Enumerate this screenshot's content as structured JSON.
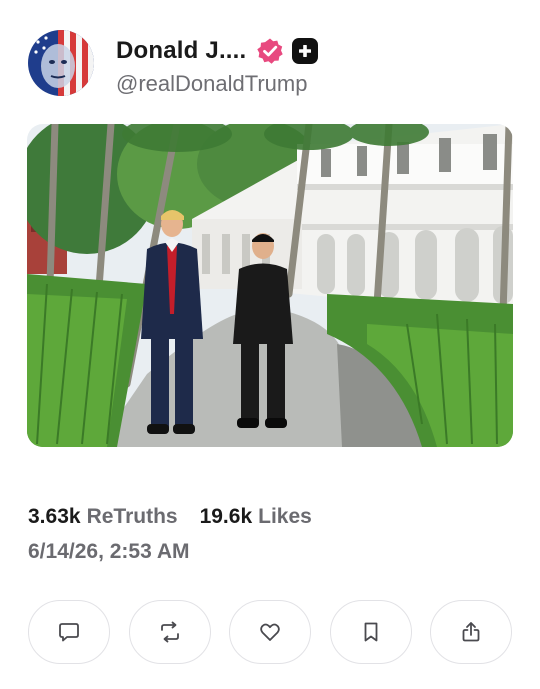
{
  "post": {
    "author": {
      "display_name": "Donald J....",
      "handle": "@realDonaldTrump",
      "verified_icon": "verified-badge-icon",
      "plus_icon": "plus-badge-icon"
    },
    "media": {
      "icon": "photo"
    },
    "stats": {
      "retruths_count": "3.63k",
      "retruths_label": "ReTruths",
      "likes_count": "19.6k",
      "likes_label": "Likes"
    },
    "timestamp": "6/14/26, 2:53 AM"
  },
  "actions": [
    {
      "name": "reply",
      "icon": "comment-icon"
    },
    {
      "name": "retruth",
      "icon": "repost-icon"
    },
    {
      "name": "like",
      "icon": "heart-icon"
    },
    {
      "name": "bookmark",
      "icon": "bookmark-icon"
    },
    {
      "name": "share",
      "icon": "share-icon"
    }
  ],
  "colors": {
    "verified": "#e8497f",
    "text_primary": "#1a1a1a",
    "text_secondary": "#6b6b70",
    "button_border": "#e2e2e6"
  }
}
